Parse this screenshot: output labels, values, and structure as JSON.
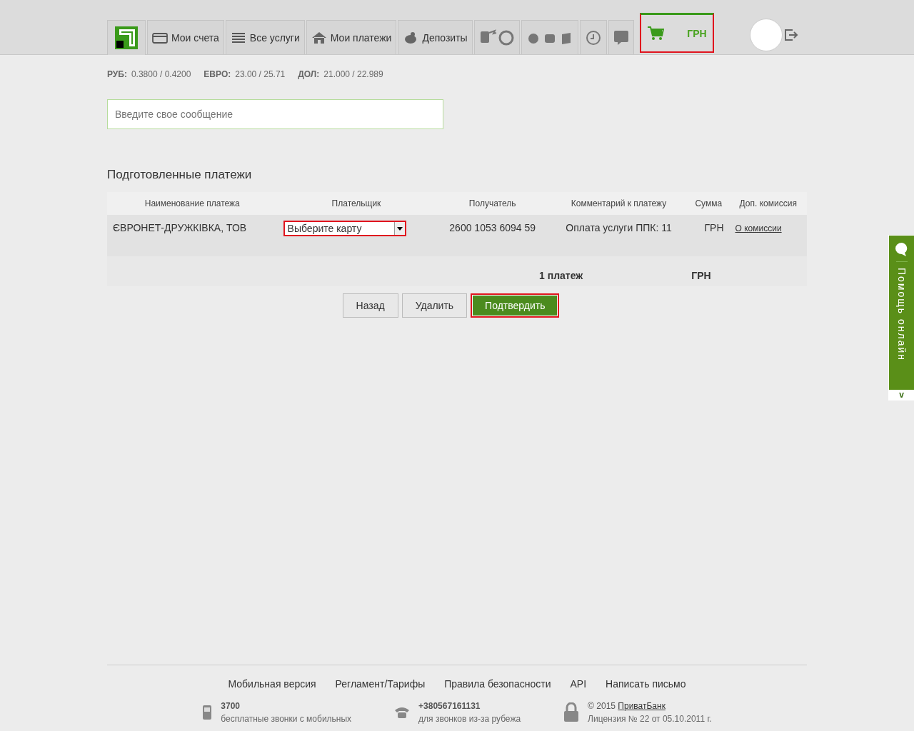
{
  "nav": {
    "items": [
      {
        "kind": "text",
        "label": "Мои счета"
      },
      {
        "kind": "text",
        "label": "Все услуги"
      },
      {
        "kind": "text",
        "label": "Мои платежи"
      },
      {
        "kind": "text",
        "label": "Депозиты"
      },
      {
        "kind": "icons"
      },
      {
        "kind": "icons"
      },
      {
        "kind": "icons"
      },
      {
        "kind": "icons"
      }
    ],
    "cart": {
      "currency": "ГРН",
      "highlighted": true
    }
  },
  "rates": [
    {
      "code": "РУБ:",
      "value": "0.3800 / 0.4200"
    },
    {
      "code": "ЕВРО:",
      "value": "23.00 / 25.71"
    },
    {
      "code": "ДОЛ:",
      "value": "21.000 / 22.989"
    }
  ],
  "message_field": {
    "placeholder": "Введите свое сообщение"
  },
  "section_title": "Подготовленные платежи",
  "table": {
    "columns": [
      "Наименование платежа",
      "Плательщик",
      "Получатель",
      "Комментарий к платежу",
      "Сумма",
      "Доп. комиссия"
    ],
    "rows": [
      {
        "name": "ЄВРОНЕТ-ДРУЖКІВКА, ТОВ",
        "payer": {
          "placeholder": "Выберите карту",
          "highlighted": true
        },
        "recipient": "2600 1053 6094 59",
        "comment": "Оплата услуги ППК: 11",
        "currency": "ГРН",
        "commission_link": "О комиссии"
      }
    ]
  },
  "total": {
    "count": "1 платеж",
    "currency": "ГРН"
  },
  "buttons": [
    {
      "label": "Назад",
      "kind": "secondary",
      "highlighted": false
    },
    {
      "label": "Удалить",
      "kind": "secondary",
      "highlighted": false
    },
    {
      "label": "Подтвердить",
      "kind": "primary",
      "highlighted": true
    }
  ],
  "footer": {
    "links": [
      "Мобильная версия",
      "Регламент/Тарифы",
      "Правила безопасности",
      "API",
      "Написать письмо"
    ],
    "contacts": [
      {
        "kind": "mobile",
        "title": "3700",
        "subtitle": "бесплатные звонки с мобильных"
      },
      {
        "kind": "phone",
        "title": "+380567161131",
        "subtitle": "для звонков из-за рубежа"
      },
      {
        "kind": "lock",
        "copyright": "© 2015",
        "link": "ПриватБанк",
        "subtitle": "Лицензия № 22 от 05.10.2011 г."
      }
    ]
  },
  "side_tab": {
    "label": "Помощь онлайн",
    "toggle": "v"
  }
}
